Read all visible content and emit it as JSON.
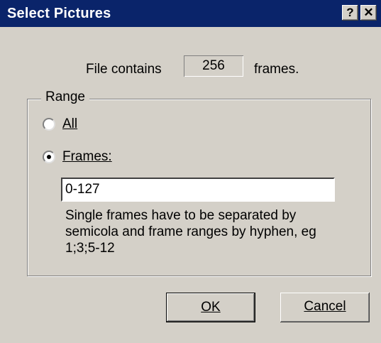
{
  "window": {
    "title": "Select Pictures",
    "help_glyph": "?",
    "close_glyph": "✕"
  },
  "file_info": {
    "prefix": "File contains",
    "frame_count": "256",
    "suffix": "frames."
  },
  "range": {
    "legend": "Range",
    "all_label": "All",
    "frames_label": "Frames:",
    "selected": "frames",
    "frames_value": "0-127",
    "hint": "Single frames have to be separated by semicola and frame ranges by hyphen, eg 1;3;5-12"
  },
  "buttons": {
    "ok": "OK",
    "cancel": "Cancel"
  },
  "colors": {
    "titlebar": "#0a246a",
    "face": "#d4d0c8"
  }
}
